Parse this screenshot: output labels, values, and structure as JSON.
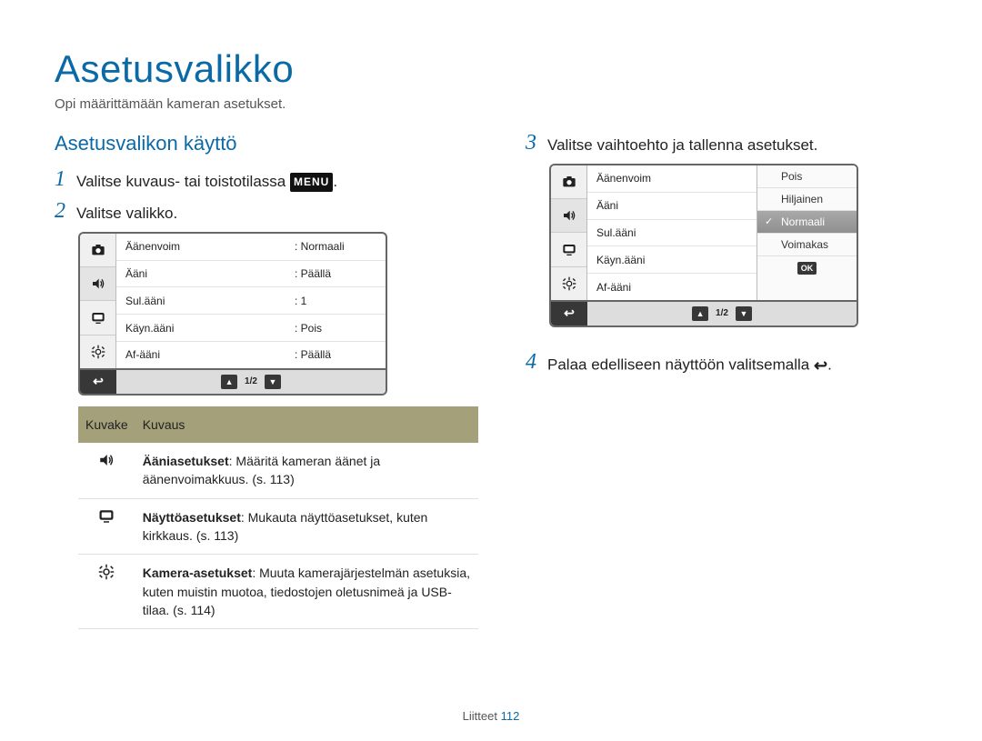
{
  "page": {
    "title": "Asetusvalikko",
    "subtitle": "Opi määrittämään kameran asetukset.",
    "section": "Asetusvalikon käyttö",
    "footer_label": "Liitteet",
    "footer_page": "112"
  },
  "steps": {
    "s1_num": "1",
    "s1_text_a": "Valitse kuvaus- tai toistotilassa ",
    "s1_menu_glyph": "MENU",
    "s1_text_b": ".",
    "s2_num": "2",
    "s2_text": "Valitse valikko.",
    "s3_num": "3",
    "s3_text": "Valitse vaihtoehto ja tallenna asetukset.",
    "s4_num": "4",
    "s4_text_a": "Palaa edelliseen näyttöön valitsemalla ",
    "s4_text_b": "."
  },
  "screen1": {
    "rows": [
      {
        "label": "Äänenvoim",
        "value": ": Normaali"
      },
      {
        "label": "Ääni",
        "value": ": Päällä"
      },
      {
        "label": "Sul.ääni",
        "value": ": 1"
      },
      {
        "label": "Käyn.ääni",
        "value": ": Pois"
      },
      {
        "label": "Af-ääni",
        "value": ": Päällä"
      }
    ],
    "pager": "1/2"
  },
  "screen2": {
    "rows": [
      {
        "label": "Äänenvoim"
      },
      {
        "label": "Ääni"
      },
      {
        "label": "Sul.ääni"
      },
      {
        "label": "Käyn.ääni"
      },
      {
        "label": "Af-ääni"
      }
    ],
    "options": [
      {
        "label": "Pois",
        "selected": false
      },
      {
        "label": "Hiljainen",
        "selected": false
      },
      {
        "label": "Normaali",
        "selected": true
      },
      {
        "label": "Voimakas",
        "selected": false
      }
    ],
    "ok": "OK",
    "pager": "1/2"
  },
  "desc_table": {
    "head_icon": "Kuvake",
    "head_desc": "Kuvaus",
    "rows": [
      {
        "bold": "Ääniasetukset",
        "text": ": Määritä kameran äänet ja äänenvoimakkuus. (s. 113)"
      },
      {
        "bold": "Näyttöasetukset",
        "text": ": Mukauta näyttöasetukset, kuten kirkkaus. (s. 113)"
      },
      {
        "bold": "Kamera-asetukset",
        "text": ": Muuta kamerajärjestelmän asetuksia, kuten muistin muotoa, tiedostojen oletusnimeä ja USB-tilaa. (s. 114)"
      }
    ]
  },
  "icons": {
    "camera": "camera-icon",
    "speaker": "speaker-icon",
    "display": "display-icon",
    "gear": "gear-icon",
    "back": "↩",
    "up": "▲",
    "down": "▼",
    "check": "✓"
  }
}
